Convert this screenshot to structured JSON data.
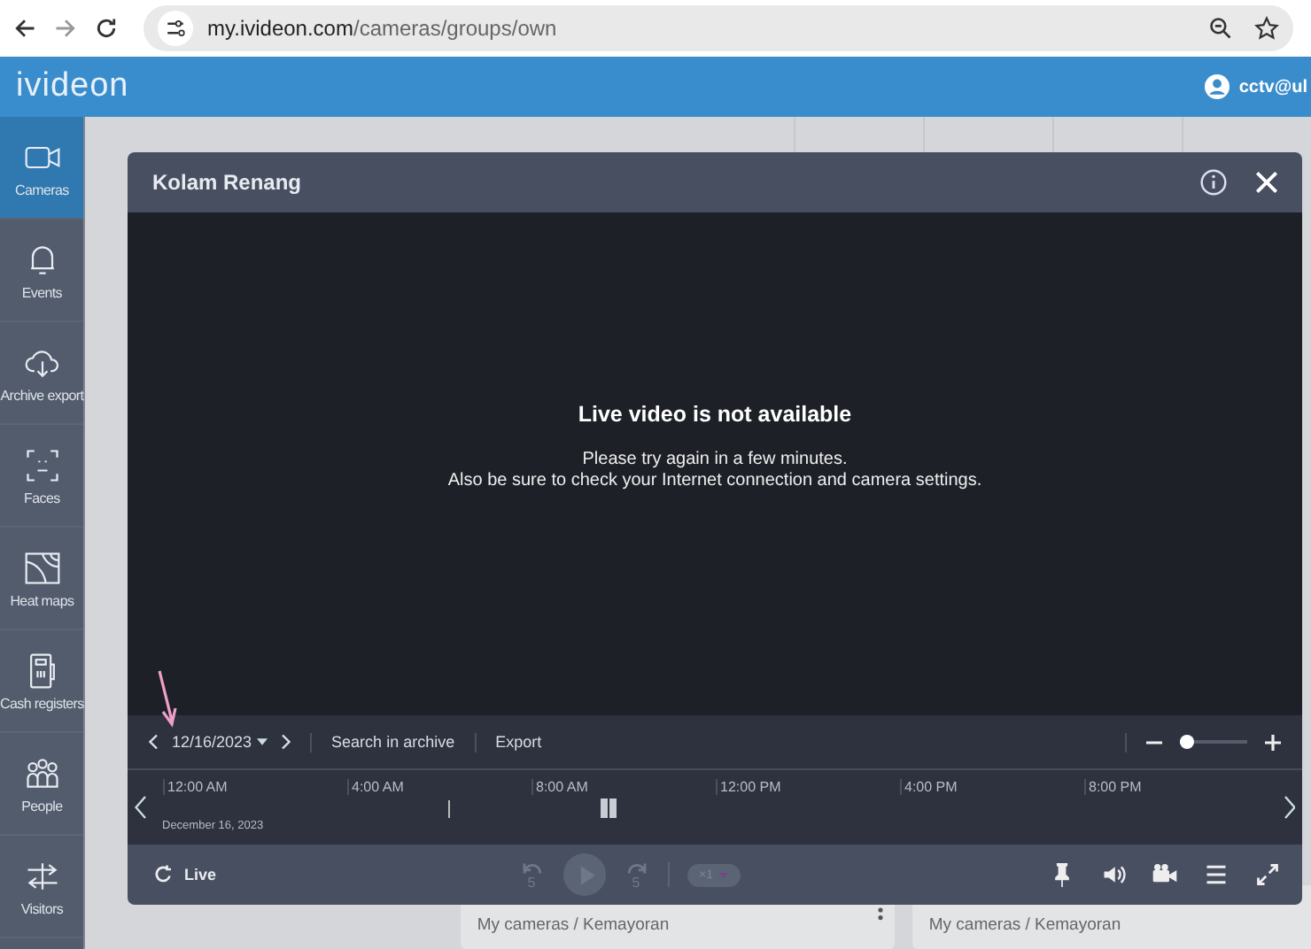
{
  "browser": {
    "url_host": "my.ivideon.com",
    "url_path": "/cameras/groups/own"
  },
  "header": {
    "logo": "ivideon",
    "user": "cctv@ul"
  },
  "sidebar": {
    "items": [
      {
        "label": "Cameras",
        "selected": true
      },
      {
        "label": "Events",
        "selected": false
      },
      {
        "label": "Archive export",
        "selected": false
      },
      {
        "label": "Faces",
        "selected": false
      },
      {
        "label": "Heat maps",
        "selected": false
      },
      {
        "label": "Cash registers",
        "selected": false
      },
      {
        "label": "People",
        "selected": false
      },
      {
        "label": "Visitors",
        "selected": false
      }
    ]
  },
  "cards": [
    {
      "path": "My cameras / Kemayoran"
    },
    {
      "path": "My cameras / Kemayoran"
    }
  ],
  "player": {
    "title": "Kolam Renang",
    "message_title": "Live video is not available",
    "message_lines": [
      "Please try again in a few minutes.",
      "Also be sure to check your Internet connection and camera settings."
    ],
    "date": "12/16/2023",
    "search": "Search in archive",
    "export": "Export",
    "zoom": {
      "level": 0.1
    },
    "timeline": {
      "ticks": [
        "12:00 AM",
        "4:00 AM",
        "8:00 AM",
        "12:00 PM",
        "4:00 PM",
        "8:00 PM"
      ],
      "date_label": "December 16, 2023"
    },
    "live": "Live",
    "rewind": "5",
    "forward": "5",
    "speed": "×1"
  }
}
